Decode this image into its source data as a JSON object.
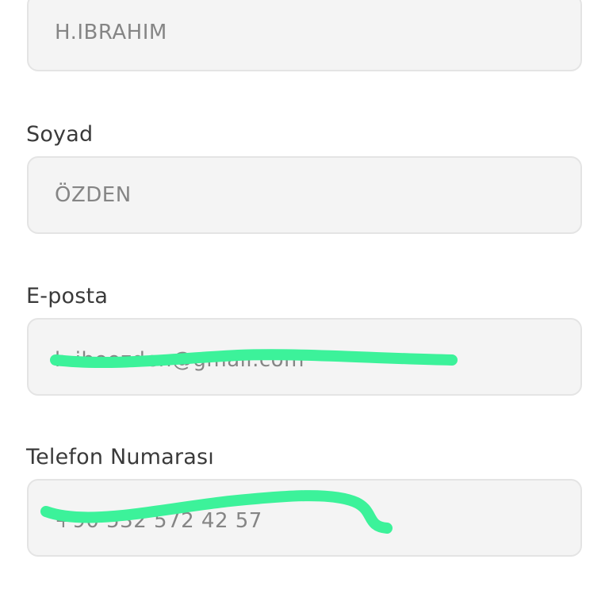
{
  "form": {
    "first_name": {
      "value": "H.IBRAHIM"
    },
    "last_name": {
      "label": "Soyad",
      "value": "ÖZDEN"
    },
    "email": {
      "label": "E-posta",
      "value": "h.iboozden@gmail.com"
    },
    "phone": {
      "label": "Telefon Numarası",
      "value": "+90 532 572 42 57"
    }
  },
  "colors": {
    "field_background": "#f4f4f4",
    "field_border": "#e4e4e4",
    "label_text": "#3a3a3a",
    "value_text": "#858585",
    "redaction_marker": "#3cf29a"
  }
}
